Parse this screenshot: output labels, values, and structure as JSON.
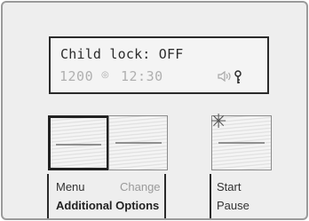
{
  "display": {
    "status_text": "Child lock: OFF",
    "spin_speed": "1200",
    "time": "12:30"
  },
  "buttons": {
    "menu_label": "Menu",
    "change_label": "Change",
    "additional_options_label": "Additional Options",
    "start_label": "Start",
    "pause_label": "Pause"
  },
  "icons": {
    "spin": "spin-icon",
    "sound": "speaker-icon",
    "key": "key-icon",
    "start_indicator": "start-indicator-icon"
  }
}
